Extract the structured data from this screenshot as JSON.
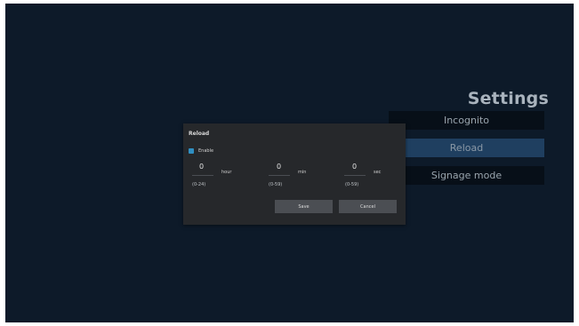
{
  "settings": {
    "title": "Settings",
    "menu": [
      {
        "label": "Incognito",
        "state": "normal"
      },
      {
        "label": "Reload",
        "state": "selected"
      },
      {
        "label": "Signage mode",
        "state": "normal"
      }
    ]
  },
  "dialog": {
    "title": "Reload",
    "enable_label": "Enable",
    "enable_checked": true,
    "fields": {
      "hour": {
        "value": "0",
        "unit": "hour",
        "range": "(0-24)"
      },
      "min": {
        "value": "0",
        "unit": "min",
        "range": "(0-59)"
      },
      "sec": {
        "value": "0",
        "unit": "sec",
        "range": "(0-59)"
      }
    },
    "buttons": {
      "save": "Save",
      "cancel": "Cancel"
    }
  },
  "colors": {
    "background": "#0d1a29",
    "dialog": "#26282b",
    "menu_item": "#070f18",
    "menu_selected": "#1f3f60",
    "checkbox": "#2f8fc2"
  }
}
